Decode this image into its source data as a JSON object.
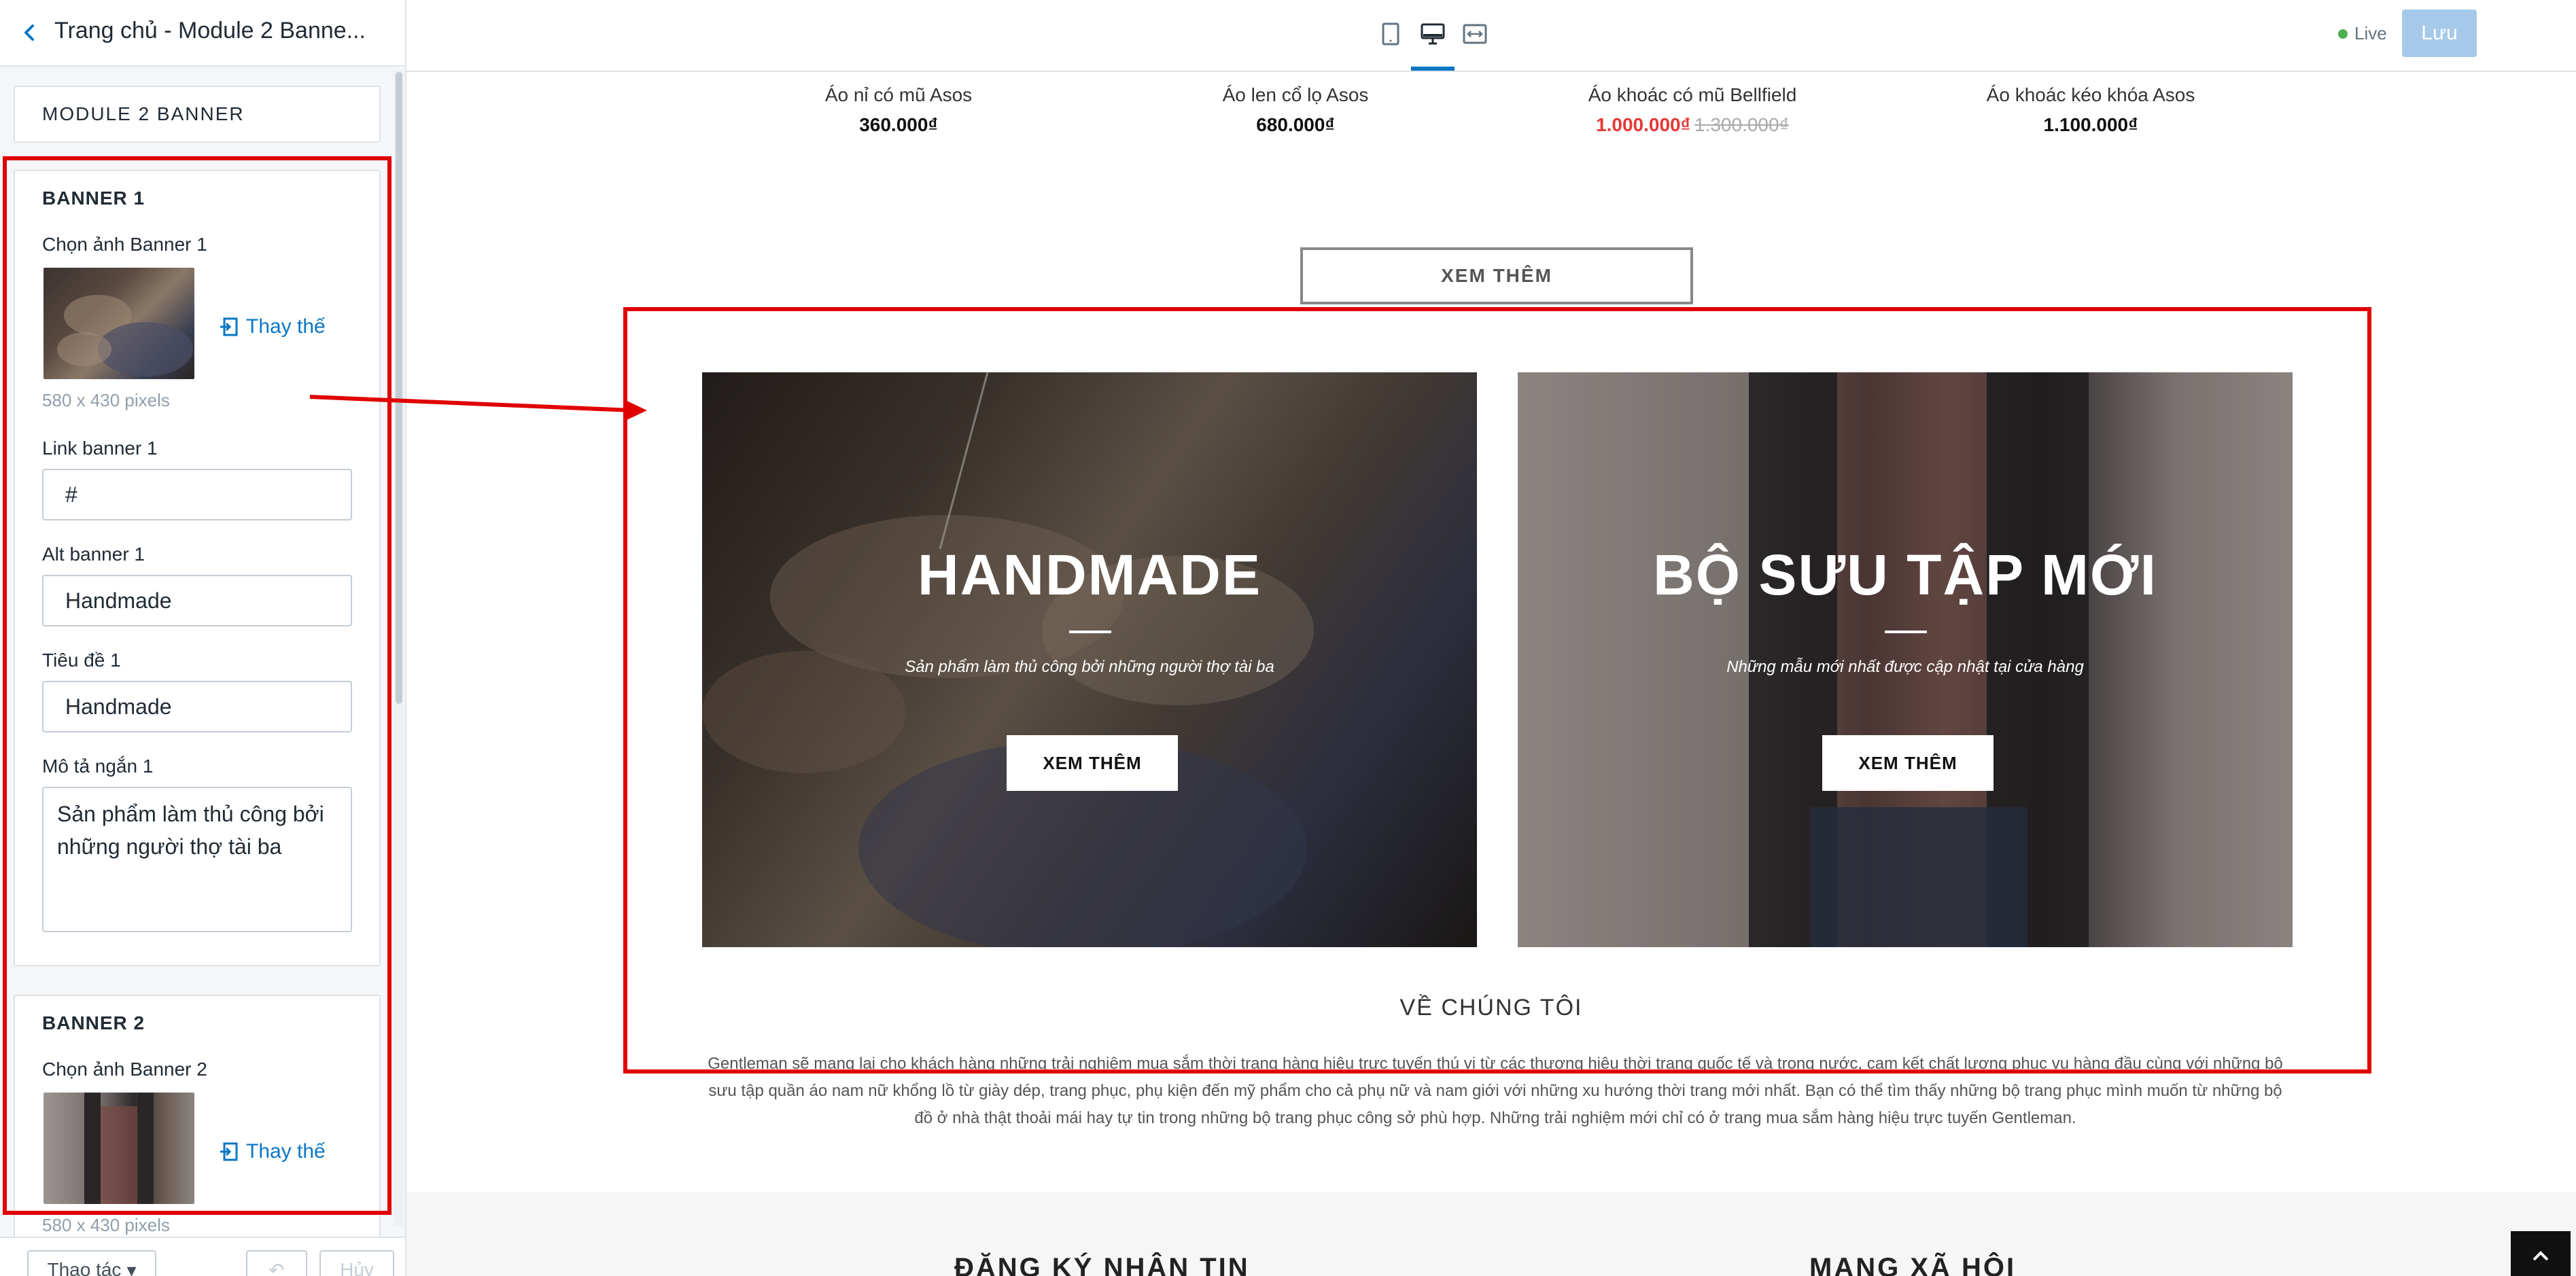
{
  "sidebar": {
    "title": "Trang chủ - Module 2 Banne...",
    "module_label": "MODULE 2 BANNER",
    "banner1": {
      "section": "BANNER 1",
      "image_label": "Chọn ảnh Banner 1",
      "replace": "Thay thế",
      "size": "580 x 430 pixels",
      "link_label": "Link banner 1",
      "link_value": "#",
      "alt_label": "Alt banner 1",
      "alt_value": "Handmade",
      "title_label": "Tiêu đề 1",
      "title_value": "Handmade",
      "desc_label": "Mô tả ngắn 1",
      "desc_value": "Sản phẩm làm thủ công bởi những người thợ tài ba"
    },
    "banner2": {
      "section": "BANNER 2",
      "image_label": "Chọn ảnh Banner 2",
      "replace": "Thay thế",
      "size": "580 x 430 pixels"
    },
    "footer": {
      "actions": "Thao tác",
      "undo": "Hủy"
    }
  },
  "topbar": {
    "live": "Live",
    "save": "Lưu"
  },
  "products": [
    {
      "name": "Áo nỉ có mũ Asos",
      "price": "360.000₫"
    },
    {
      "name": "Áo len cổ lọ Asos",
      "price": "680.000₫"
    },
    {
      "name": "Áo khoác có mũ Bellfield",
      "price": "1.000.000₫",
      "old_price": "1.300.000₫"
    },
    {
      "name": "Áo khoác kéo khóa Asos",
      "price": "1.100.000₫"
    }
  ],
  "more_button": "XEM THÊM",
  "banners": [
    {
      "title": "HANDMADE",
      "desc": "Sản phẩm làm thủ công bởi những người thợ tài ba",
      "button": "XEM THÊM"
    },
    {
      "title": "BỘ SƯU TẬP MỚI",
      "desc": "Những mẫu mới nhất được cập nhật tại cửa hàng",
      "button": "XEM THÊM"
    }
  ],
  "about": {
    "title": "VỀ CHÚNG TÔI",
    "text": "Gentleman sẽ mang lại cho khách hàng những trải nghiệm mua sắm thời trang hàng hiệu trực tuyến thú vị từ các thương hiệu thời trang quốc tế và trong nước, cam kết chất lượng phục vụ hàng đầu cùng với những bộ sưu tập quần áo nam nữ khổng lồ từ giày dép, trang phục, phụ kiện đến mỹ phẩm cho cả phụ nữ và nam giới với những xu hướng thời trang mới nhất. Bạn có thể tìm thấy những bộ trang phục mình muốn từ những bộ đồ ở nhà thật thoải mái hay tự tin trong những bộ trang phục công sở phù hợp. Những trải nghiệm mới chỉ có ở trang mua sắm hàng hiệu trực tuyến Gentleman."
  },
  "footer": {
    "newsletter": "ĐĂNG KÝ NHẬN TIN",
    "social": "MẠNG XÃ HỘI"
  },
  "colors": {
    "accent": "#0a76c5",
    "annotation": "#e00000",
    "sale": "#e53935",
    "save_button": "#a6c9ea"
  },
  "icons": [
    "back-arrow-icon",
    "tablet-icon",
    "desktop-icon",
    "fullwidth-icon",
    "replace-icon",
    "chevron-down-icon",
    "undo-icon",
    "arrow-up-icon"
  ]
}
